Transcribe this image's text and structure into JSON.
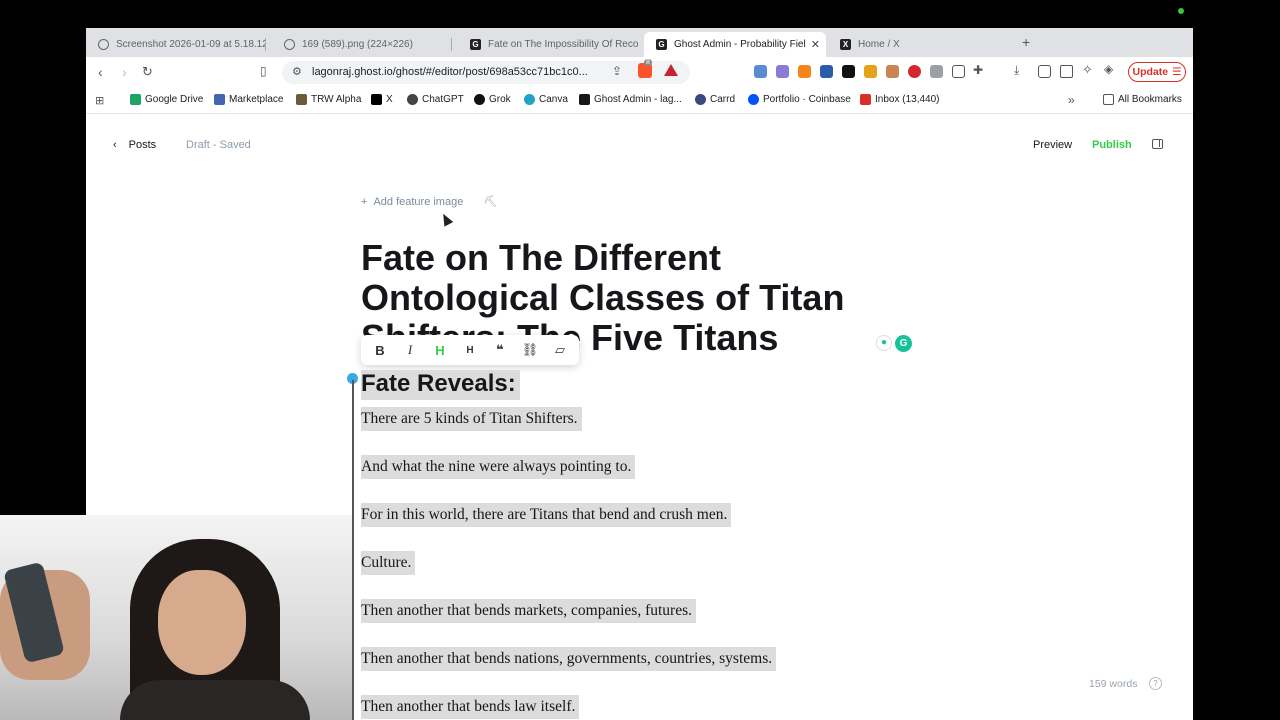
{
  "tabs": [
    {
      "title": "Screenshot 2026-01-09 at 5.18.12",
      "active": false
    },
    {
      "title": "169 (589).png (224×226)",
      "active": false
    },
    {
      "title": "Fate on The Impossibility Of Recog",
      "active": false
    },
    {
      "title": "Ghost Admin - Probability Fiel",
      "active": true
    },
    {
      "title": "Home / X",
      "active": false
    }
  ],
  "toolbar": {
    "url": "lagonraj.ghost.io/ghost/#/editor/post/698a53cc71bc1c0...",
    "update_label": "Update",
    "brave_badge": "8"
  },
  "bookmarks": [
    {
      "label": "Google Drive",
      "color": "#1fa463"
    },
    {
      "label": "Marketplace",
      "color": "#4267b2"
    },
    {
      "label": "TRW Alpha",
      "color": "#6b5b3a"
    },
    {
      "label": "X",
      "color": "#000000"
    },
    {
      "label": "ChatGPT",
      "color": "#444444"
    },
    {
      "label": "Grok",
      "color": "#111111"
    },
    {
      "label": "Canva",
      "color": "#20a3c9"
    },
    {
      "label": "Ghost Admin - lag...",
      "color": "#15171a"
    },
    {
      "label": "Carrd",
      "color": "#3a4a7a"
    },
    {
      "label": "Portfolio · Coinbase",
      "color": "#0052ff"
    },
    {
      "label": "Inbox (13,440)",
      "color": "#d93025"
    }
  ],
  "all_bookmarks_label": "All Bookmarks",
  "editor": {
    "back_label": "Posts",
    "status": "Draft - Saved",
    "preview_label": "Preview",
    "publish_label": "Publish",
    "add_feature_image": "Add feature image",
    "title": "Fate on The Different Ontological Classes of Titan Shifters: The Five Titans",
    "heading": "Fate Reveals:",
    "paragraphs": [
      "There are 5 kinds of Titan Shifters.",
      "And what the nine were always pointing to.",
      "For in this world, there are Titans that bend and crush men.",
      "Culture.",
      "Then another that bends markets, companies, futures.",
      "Then another that bends nations, governments, countries, systems.",
      "Then another that bends law itself."
    ],
    "word_count": "159 words"
  }
}
